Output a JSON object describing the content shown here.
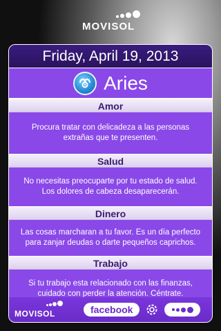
{
  "brand": {
    "name": "MOVISOL",
    "logo_icon": "dots-logo-icon"
  },
  "date": "Friday, April 19, 2013",
  "sign": {
    "name": "Aries",
    "icon": "aries-ram-icon"
  },
  "sections": {
    "amor": {
      "title": "Amor",
      "text": "Procura tratar con delicadeza a las personas extrañas que te presenten."
    },
    "salud": {
      "title": "Salud",
      "text": "No necesitas preocuparte por tu estado de salud. Los dolores de cabeza desaparecerán."
    },
    "dinero": {
      "title": "Dinero",
      "text": "Las cosas marcharan a tu favor. Es un día perfecto para zanjar deudas o darte pequeños caprichos."
    },
    "trabajo": {
      "title": "Trabajo",
      "text": "Si tu trabajo esta relacionado con las finanzas, cuidado con perder la atención. Céntrate."
    }
  },
  "footer": {
    "brand": "MOVISOL",
    "facebook_label": "facebook",
    "settings_icon": "gear-icon",
    "more_icon": "dots-more-icon"
  },
  "colors": {
    "card": "#8a48e8",
    "date_bar": "#2a135e",
    "section_head_text": "#3a1c6e",
    "footer": "#6a2bc8"
  }
}
